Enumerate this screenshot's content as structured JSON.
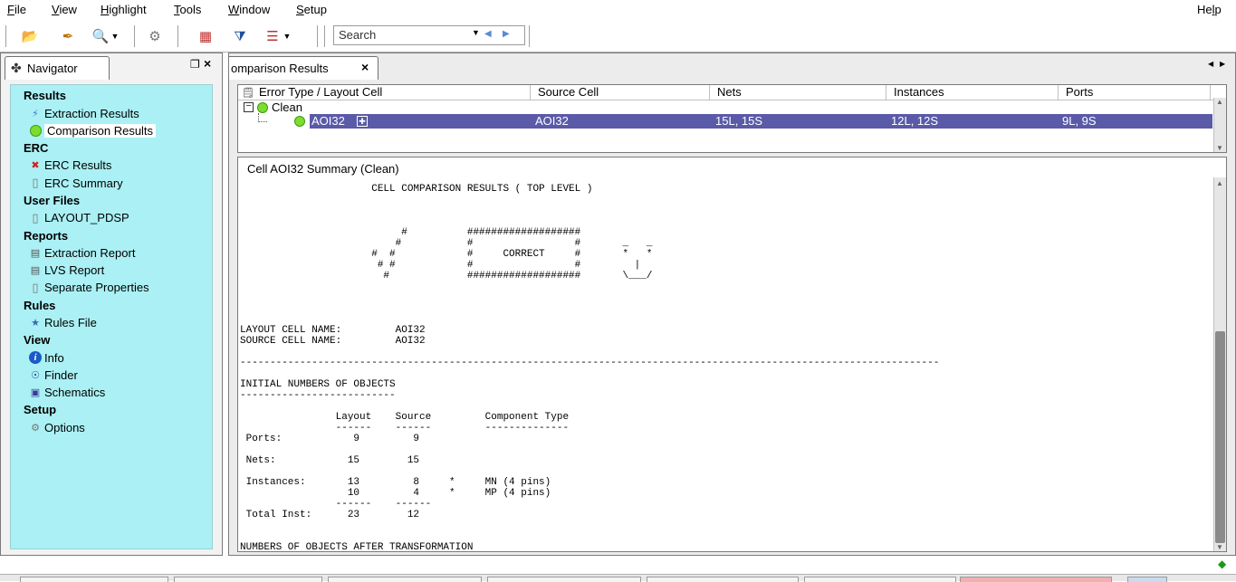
{
  "menubar": {
    "items": [
      "File",
      "View",
      "Highlight",
      "Tools",
      "Window",
      "Setup"
    ],
    "help": "Help"
  },
  "toolbar": {
    "search_placeholder": "Search"
  },
  "navigator": {
    "tab_label": "Navigator",
    "sections": [
      {
        "title": "Results",
        "items": [
          {
            "label": "Extraction Results",
            "icon": "extraction-icon"
          },
          {
            "label": "Comparison Results",
            "icon": "smiley-icon",
            "selected": true
          }
        ]
      },
      {
        "title": "ERC",
        "items": [
          {
            "label": "ERC Results",
            "icon": "red-x-icon"
          },
          {
            "label": "ERC Summary",
            "icon": "document-icon"
          }
        ]
      },
      {
        "title": "User Files",
        "items": [
          {
            "label": "LAYOUT_PDSP",
            "icon": "file-icon"
          }
        ]
      },
      {
        "title": "Reports",
        "items": [
          {
            "label": "Extraction Report",
            "icon": "report-icon"
          },
          {
            "label": "LVS Report",
            "icon": "report-icon"
          },
          {
            "label": "Separate Properties",
            "icon": "file-icon"
          }
        ]
      },
      {
        "title": "Rules",
        "items": [
          {
            "label": "Rules File",
            "icon": "rules-icon"
          }
        ]
      },
      {
        "title": "View",
        "items": [
          {
            "label": "Info",
            "icon": "info-icon"
          },
          {
            "label": "Finder",
            "icon": "binoculars-icon"
          },
          {
            "label": "Schematics",
            "icon": "schematic-icon"
          }
        ]
      },
      {
        "title": "Setup",
        "items": [
          {
            "label": "Options",
            "icon": "gear-icon"
          }
        ]
      }
    ]
  },
  "main": {
    "tab_label": "omparison Results",
    "columns": [
      "Error Type / Layout Cell",
      "Source Cell",
      "Nets",
      "Instances",
      "Ports"
    ],
    "group_label": "Clean",
    "row": {
      "layout_cell": "AOI32",
      "source_cell": "AOI32",
      "nets": "15L, 15S",
      "instances": "12L, 12S",
      "ports": "9L, 9S"
    },
    "summary_title": "Cell AOI32 Summary (Clean)",
    "report_text": "                      CELL COMPARISON RESULTS ( TOP LEVEL )\n\n\n\n                           #          ###################\n                          #           #                 #       _   _\n                      #  #            #     CORRECT     #       *   *\n                       # #            #                 #         |\n                        #             ###################       \\___/\n\n\n\n\nLAYOUT CELL NAME:         AOI32\nSOURCE CELL NAME:         AOI32\n\n---------------------------------------------------------------------------------------------------------------------\n\nINITIAL NUMBERS OF OBJECTS\n--------------------------\n\n                Layout    Source         Component Type\n                ------    ------         --------------\n Ports:            9         9\n\n Nets:            15        15\n\n Instances:       13         8     *     MN (4 pins)\n                  10         4     *     MP (4 pins)\n                ------    ------\n Total Inst:      23        12\n\n\nNUMBERS OF OBJECTS AFTER TRANSFORMATION\n---------------------------------------"
  }
}
